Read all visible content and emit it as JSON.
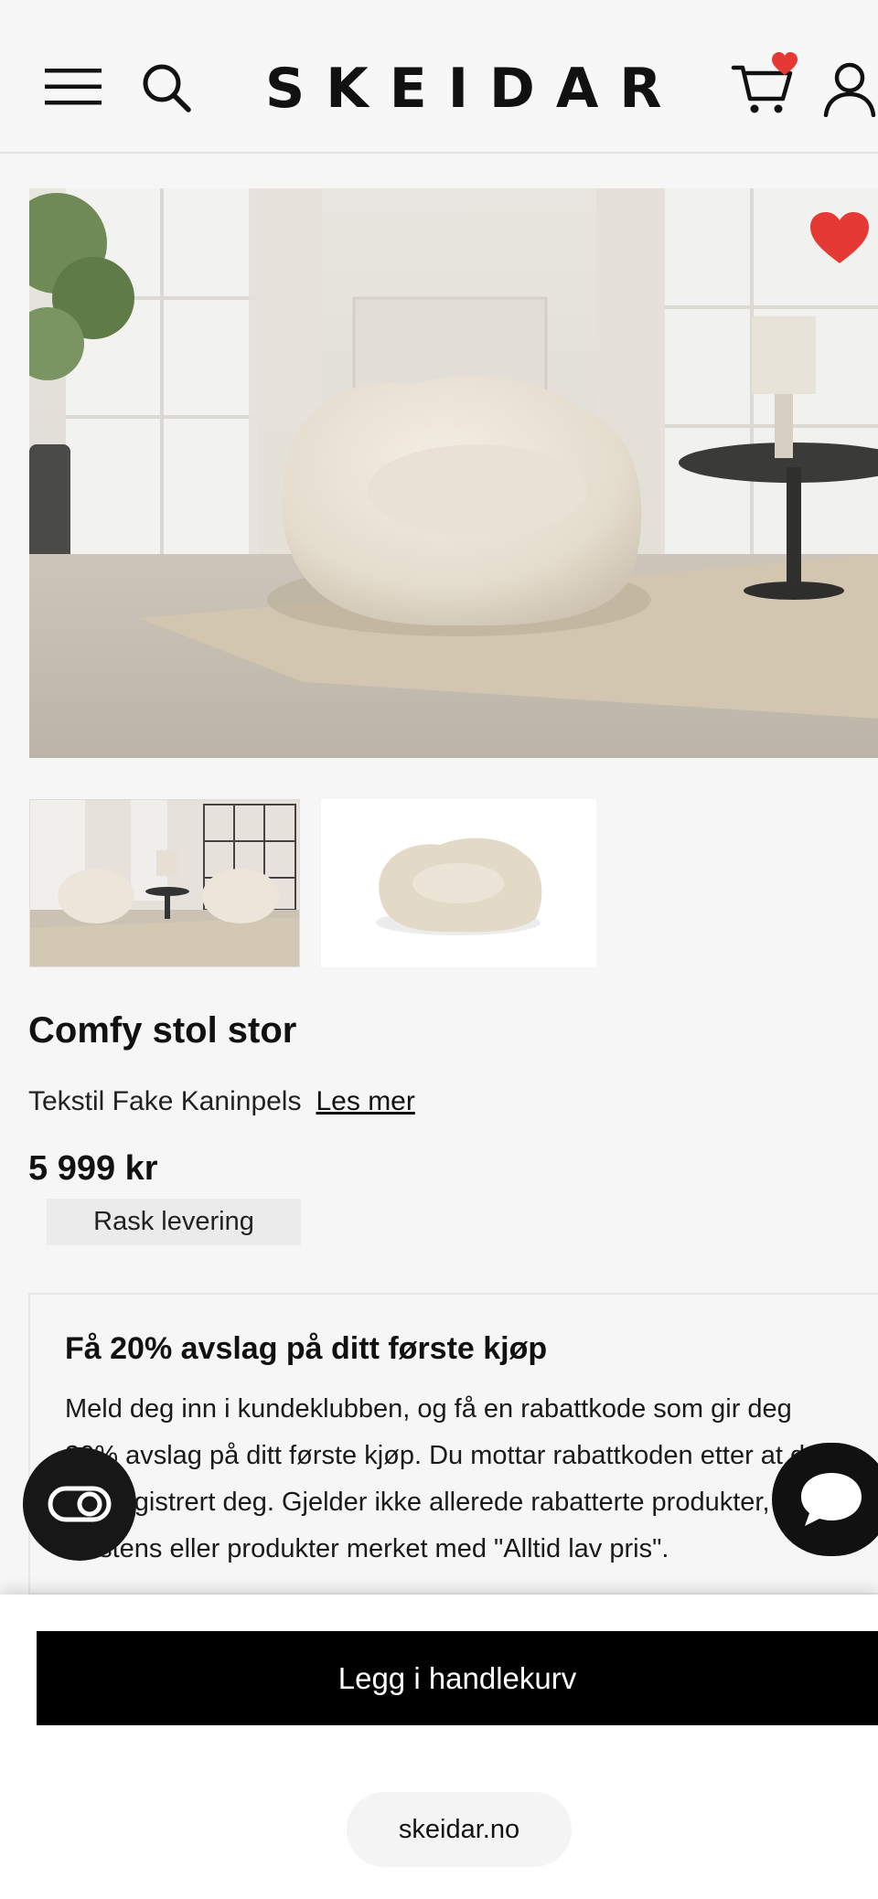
{
  "header": {
    "logo_text": "SKEIDAR",
    "icons": [
      "menu-icon",
      "search-icon",
      "cart-icon",
      "user-icon"
    ],
    "cart_badge_icon": "heart-icon",
    "cart_badge_color": "#e53935"
  },
  "product": {
    "title": "Comfy stol stor",
    "subtitle": "Tekstil Fake Kaninpels",
    "read_more": "Les mer",
    "price": "5 999 kr",
    "badge": "Rask levering",
    "favorite_color": "#e53935"
  },
  "promo": {
    "title": "Få 20% avslag på ditt første kjøp",
    "body": "Meld deg inn i kundeklubben, og få en rabattkode som gir deg 20% avslag på ditt første kjøp. Du mottar rabattkoden etter at du har registrert deg. Gjelder ikke allerede rabatterte produkter, Hästens eller produkter merket med \"Alltid lav pris\"."
  },
  "actions": {
    "add_to_cart": "Legg i handlekurv"
  },
  "browser": {
    "url": "skeidar.no"
  }
}
